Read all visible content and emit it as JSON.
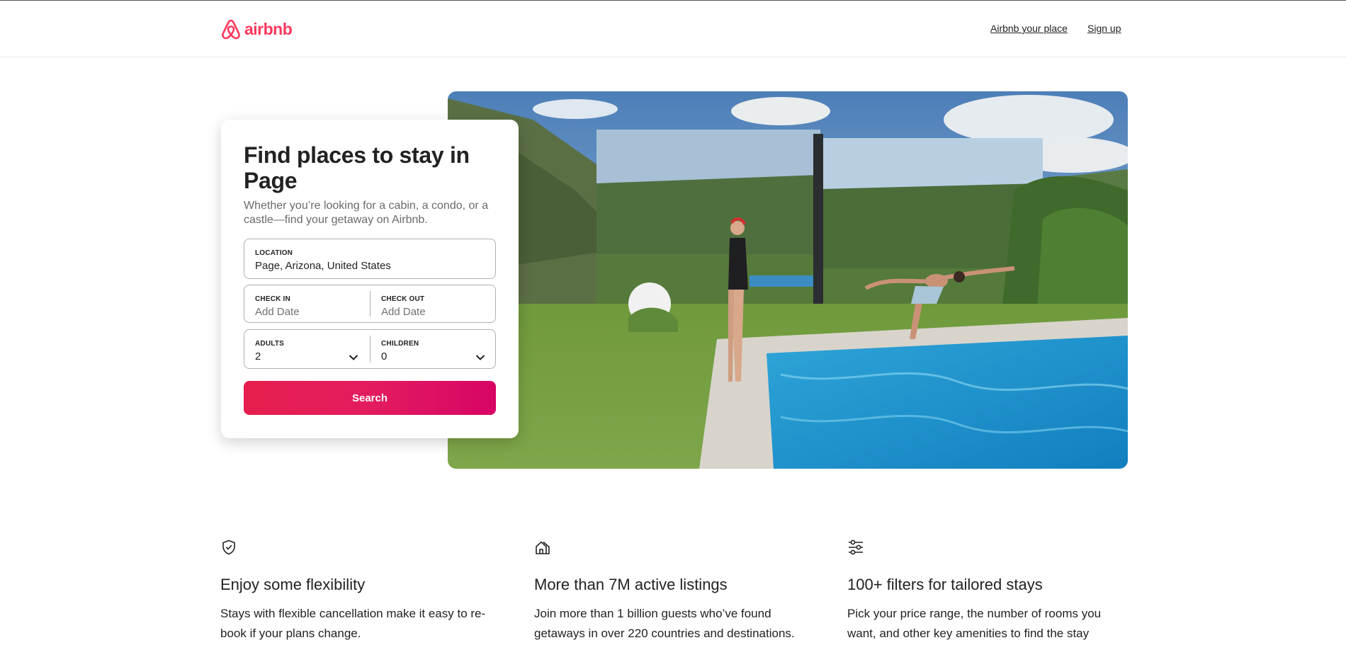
{
  "brand": {
    "name": "airbnb",
    "color": "#ff385c"
  },
  "header": {
    "host_link": "Airbnb your place",
    "signup_link": "Sign up"
  },
  "search_card": {
    "title": "Find places to stay in Page",
    "subtitle": "Whether you’re looking for a cabin, a condo, or a castle—find your getaway on Airbnb.",
    "location": {
      "label": "LOCATION",
      "value": "Page, Arizona, United States"
    },
    "check_in": {
      "label": "CHECK IN",
      "placeholder": "Add Date"
    },
    "check_out": {
      "label": "CHECK OUT",
      "placeholder": "Add Date"
    },
    "adults": {
      "label": "ADULTS",
      "value": "2"
    },
    "children": {
      "label": "CHILDREN",
      "value": "0"
    },
    "search_button": "Search",
    "button_color": "#e31c5f"
  },
  "features": [
    {
      "icon": "shield-check-icon",
      "title": "Enjoy some flexibility",
      "text": "Stays with flexible cancellation make it easy to re-book if your plans change."
    },
    {
      "icon": "houses-icon",
      "title": "More than 7M active listings",
      "text": "Join more than 1 billion guests who’ve found getaways in over 220 countries and destinations."
    },
    {
      "icon": "sliders-icon",
      "title": "100+ filters for tailored stays",
      "text": "Pick your price range, the number of rooms you want, and other key amenities to find the stay"
    }
  ]
}
